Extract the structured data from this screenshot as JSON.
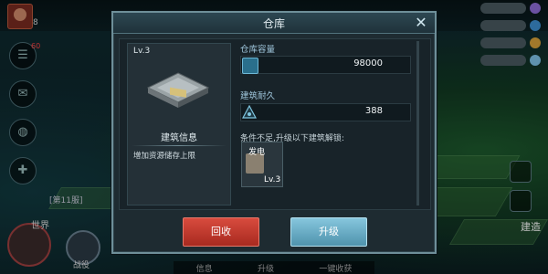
{
  "hud": {
    "player_level": "8",
    "mail_badge": "60",
    "resources": [
      {
        "value": "",
        "color": "#8e6dd8"
      },
      {
        "value": "",
        "color": "#3d8fd2"
      },
      {
        "value": "",
        "color": "#d8a23a"
      },
      {
        "value": "",
        "color": "#7fc3e8"
      }
    ],
    "bottom_tabs": [
      "信息",
      "升级",
      "一键收获"
    ],
    "world_label": "世界",
    "campaign_label": "战役",
    "chat_channel": "[第11服]",
    "build_label": "建造"
  },
  "modal": {
    "title": "仓库",
    "close_icon": "close-icon",
    "level": "Lv.3",
    "building_info_title": "建筑信息",
    "building_info_desc": "增加资源储存上限",
    "capacity_label": "仓库容量",
    "capacity_value": "98000",
    "durability_label": "建筑耐久",
    "durability_value": "388",
    "requirement_text": "条件不足,升级以下建筑解锁:",
    "required_building": {
      "name": "发电",
      "level": "Lv.3"
    },
    "recycle_button": "回收",
    "upgrade_button": "升级"
  },
  "colors": {
    "recycle": "#c9382c",
    "upgrade": "#6fb5cf"
  }
}
